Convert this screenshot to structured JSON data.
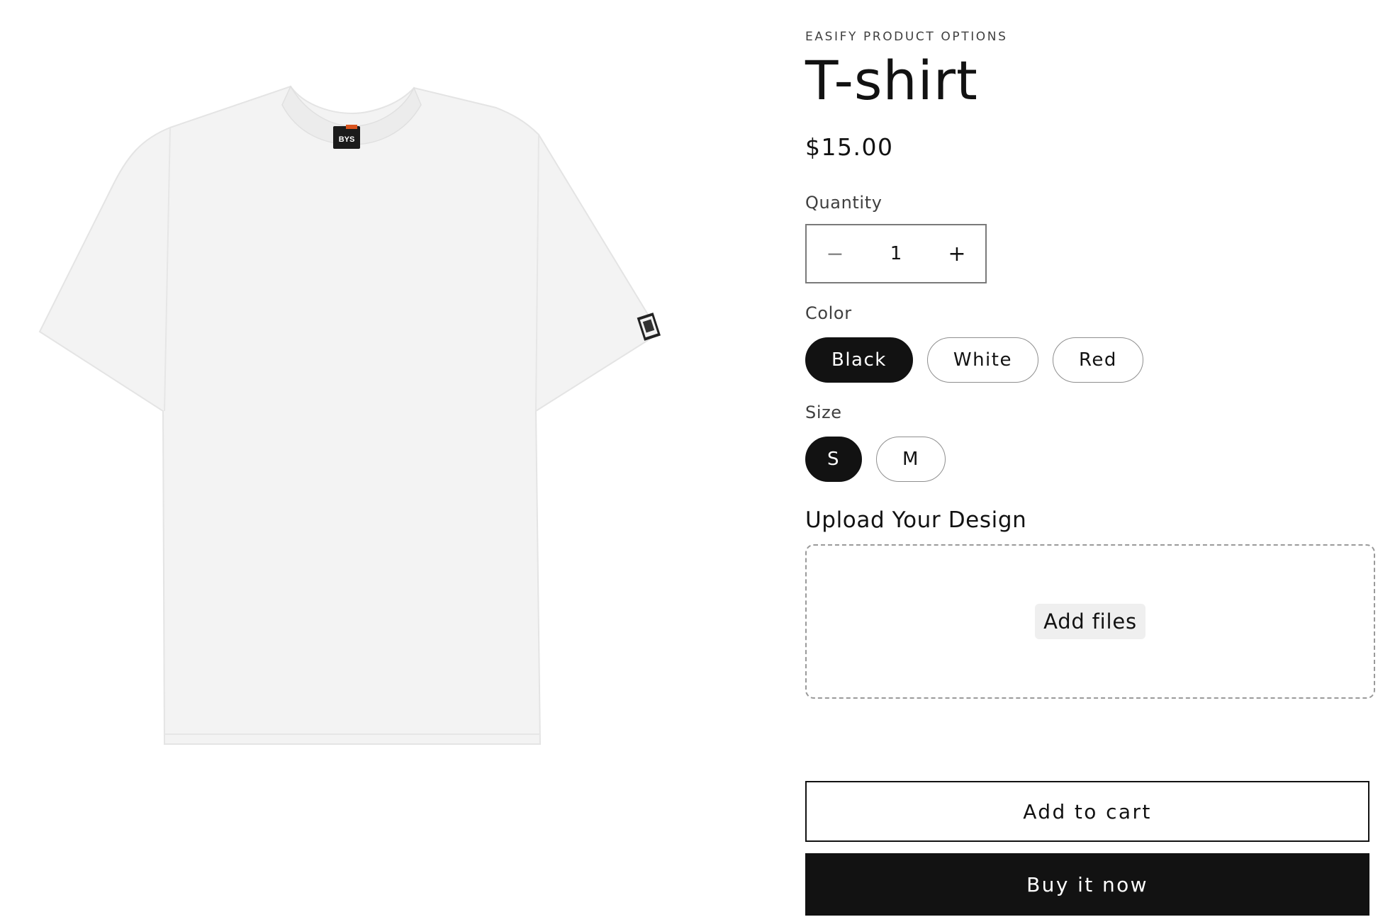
{
  "product": {
    "vendor": "EASIFY PRODUCT OPTIONS",
    "title": "T-shirt",
    "price": "$15.00",
    "image_label": "BYS"
  },
  "quantity": {
    "label": "Quantity",
    "value": "1",
    "decrement_symbol": "−",
    "increment_symbol": "+"
  },
  "options": {
    "color": {
      "label": "Color",
      "values": [
        "Black",
        "White",
        "Red"
      ],
      "selected": "Black"
    },
    "size": {
      "label": "Size",
      "values": [
        "S",
        "M"
      ],
      "selected": "S"
    }
  },
  "upload": {
    "title": "Upload Your Design",
    "button_label": "Add files"
  },
  "actions": {
    "add_to_cart": "Add to cart",
    "buy_now": "Buy it now"
  },
  "colors": {
    "primary": "#121212",
    "border": "#8f8f8f",
    "muted_text": "#3f3f3f"
  }
}
